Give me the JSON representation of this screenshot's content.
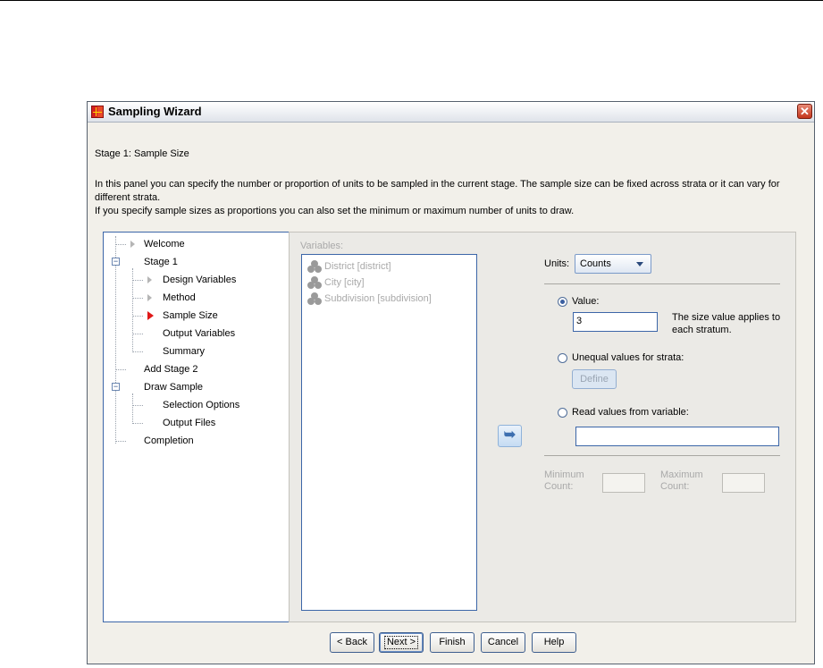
{
  "window": {
    "title": "Sampling Wizard",
    "close_glyph": "✕"
  },
  "stage_heading": "Stage 1: Sample Size",
  "description": {
    "line1": "In this panel you can specify the number or proportion of units to be sampled in the current stage. The sample size can be fixed across strata or it can vary for different strata.",
    "line2": "If you specify sample sizes as proportions you can also set the minimum or maximum number of units to draw."
  },
  "tree": {
    "items": [
      {
        "label": "Welcome"
      },
      {
        "label": "Stage 1",
        "expander": "−"
      },
      {
        "label": "Design Variables"
      },
      {
        "label": "Method"
      },
      {
        "label": "Sample Size"
      },
      {
        "label": "Output Variables"
      },
      {
        "label": "Summary"
      },
      {
        "label": "Add Stage 2"
      },
      {
        "label": "Draw Sample",
        "expander": "−"
      },
      {
        "label": "Selection Options"
      },
      {
        "label": "Output Files"
      },
      {
        "label": "Completion"
      }
    ]
  },
  "variables": {
    "label": "Variables:",
    "items": [
      {
        "label": "District [district]"
      },
      {
        "label": "City [city]"
      },
      {
        "label": "Subdivision [subdivision]"
      }
    ]
  },
  "move_button_glyph": "➥",
  "units": {
    "label": "Units:",
    "selected": "Counts"
  },
  "options": {
    "value_label": "Value:",
    "value_input": "3",
    "value_note": "The size value applies to each stratum.",
    "unequal_label": "Unequal values for strata:",
    "define_label": "Define",
    "read_label": "Read values from variable:",
    "read_input": "",
    "selected": "value"
  },
  "counts": {
    "minimum_label_line1": "Minimum",
    "minimum_label_line2": "Count:",
    "maximum_label_line1": "Maximum",
    "maximum_label_line2": "Count:"
  },
  "buttons": {
    "back": "< Back",
    "next": "Next >",
    "finish": "Finish",
    "cancel": "Cancel",
    "help": "Help"
  },
  "colors": {
    "current_step_marker": "#e01818",
    "disabled_text": "#a9a9a9",
    "list_border": "#3c66a8"
  }
}
